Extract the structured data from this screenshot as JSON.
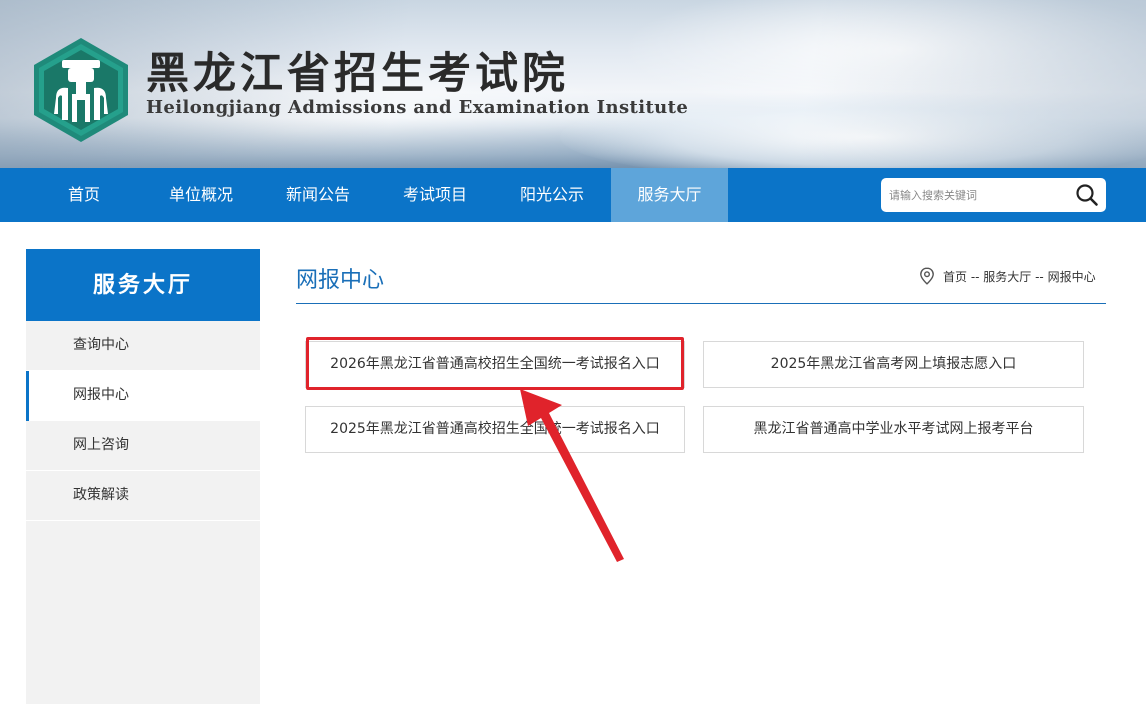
{
  "header": {
    "title_cn": "黑龙江省招生考试院",
    "title_en": "Heilongjiang Admissions and Examination Institute",
    "logo_icon": "institute-logo-icon"
  },
  "nav": {
    "items": [
      {
        "label": "首页"
      },
      {
        "label": "单位概况"
      },
      {
        "label": "新闻公告"
      },
      {
        "label": "考试项目"
      },
      {
        "label": "阳光公示"
      },
      {
        "label": "服务大厅",
        "active": true
      }
    ],
    "search_placeholder": "请输入搜索关键词",
    "search_icon": "search-icon"
  },
  "sidebar": {
    "title": "服务大厅",
    "items": [
      {
        "label": "查询中心"
      },
      {
        "label": "网报中心",
        "active": true
      },
      {
        "label": "网上咨询"
      },
      {
        "label": "政策解读"
      }
    ]
  },
  "main": {
    "title": "网报中心",
    "breadcrumb": "首页 -- 服务大厅 -- 网报中心",
    "entries": [
      {
        "label": "2026年黑龙江省普通高校招生全国统一考试报名入口",
        "highlighted": true
      },
      {
        "label": "2025年黑龙江省高考网上填报志愿入口"
      },
      {
        "label": "2025年黑龙江省普通高校招生全国统一考试报名入口"
      },
      {
        "label": "黑龙江省普通高中学业水平考试网上报考平台"
      }
    ]
  },
  "colors": {
    "primary": "#0b74c8",
    "nav_active": "#5ea5da",
    "title_blue": "#1a6fb8",
    "annotation_red": "#e0232b",
    "sidebar_bg": "#f2f2f2"
  }
}
